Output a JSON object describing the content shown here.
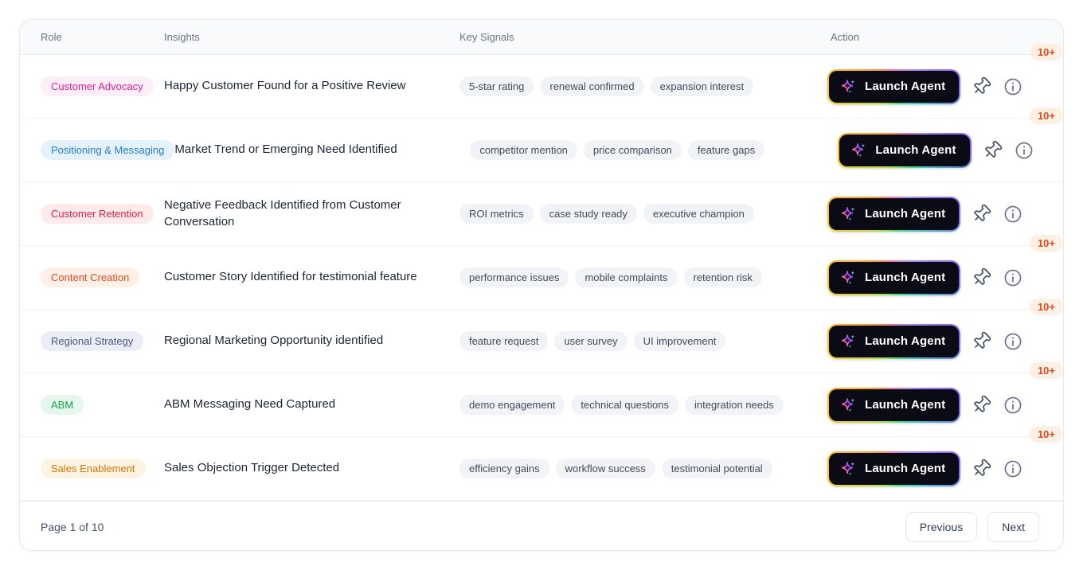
{
  "table": {
    "columns": {
      "role": "Role",
      "insights": "Insights",
      "signals": "Key Signals",
      "action": "Action"
    },
    "rows": [
      {
        "role": "Customer Advocacy",
        "role_color": "#d6219c",
        "role_bg": "#fdeef7",
        "insight": "Happy Customer Found for a Positive Review",
        "signals": [
          "5-star rating",
          "renewal confirmed",
          "expansion interest"
        ],
        "action_label": "Launch Agent",
        "count_badge": "10+"
      },
      {
        "role": "Positioning & Messaging",
        "role_color": "#1f7fc9",
        "role_bg": "#e6f2fb",
        "insight": "Market Trend or Emerging Need Identified",
        "signals": [
          "competitor mention",
          "price comparison",
          "feature gaps"
        ],
        "action_label": "Launch Agent",
        "count_badge": "10+"
      },
      {
        "role": "Customer Retention",
        "role_color": "#e11d48",
        "role_bg": "#fdebec",
        "insight": "Negative Feedback Identified from Customer Conversation",
        "signals": [
          "ROI metrics",
          "case study ready",
          "executive champion"
        ],
        "action_label": "Launch Agent",
        "count_badge": null
      },
      {
        "role": "Content Creation",
        "role_color": "#e2491f",
        "role_bg": "#feefe7",
        "insight": "Customer Story Identified for testimonial feature",
        "signals": [
          "performance issues",
          "mobile complaints",
          "retention risk"
        ],
        "action_label": "Launch Agent",
        "count_badge": "10+"
      },
      {
        "role": "Regional Strategy",
        "role_color": "#4a5878",
        "role_bg": "#eceef7",
        "insight": "Regional Marketing Opportunity identified",
        "signals": [
          "feature request",
          "user survey",
          "UI improvement"
        ],
        "action_label": "Launch Agent",
        "count_badge": "10+"
      },
      {
        "role": "ABM",
        "role_color": "#17a34a",
        "role_bg": "#e6f7ed",
        "insight": "ABM Messaging Need Captured",
        "signals": [
          "demo engagement",
          "technical questions",
          "integration needs"
        ],
        "action_label": "Launch Agent",
        "count_badge": "10+"
      },
      {
        "role": "Sales Enablement",
        "role_color": "#d97708",
        "role_bg": "#fdf3e2",
        "insight": "Sales Objection Trigger Detected",
        "signals": [
          "efficiency gains",
          "workflow success",
          "testimonial potential"
        ],
        "action_label": "Launch Agent",
        "count_badge": "10+"
      }
    ]
  },
  "icons": {
    "launch": "sparkles-icon",
    "pin": "pin-icon",
    "info": "info-icon"
  },
  "colors": {
    "count_badge_text": "#e2491d",
    "count_badge_bg": "#fcefe3",
    "button_bg": "#0b0b16",
    "header_bg": "#f9fafb"
  },
  "footer": {
    "page_label": "Page 1 of 10",
    "previous_label": "Previous",
    "next_label": "Next"
  }
}
